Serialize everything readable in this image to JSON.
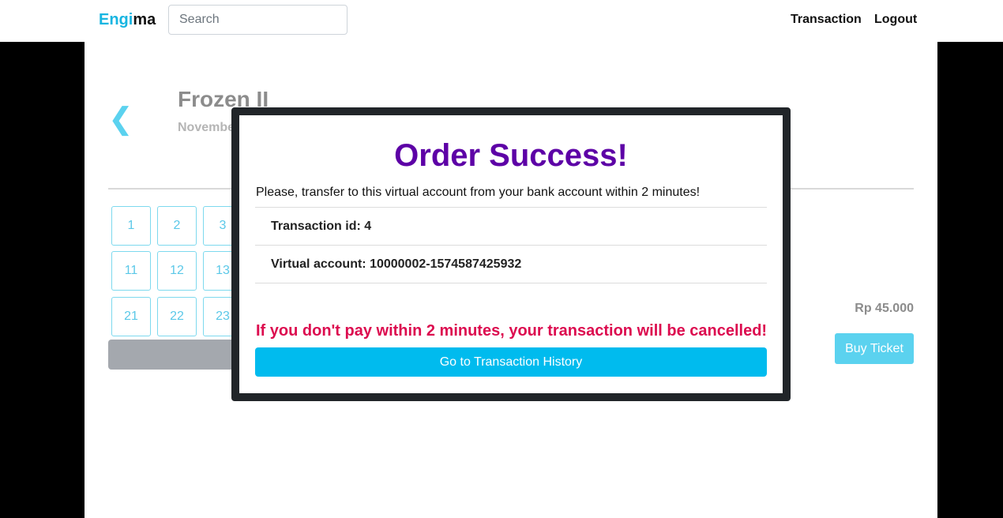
{
  "navbar": {
    "brand_part1": "Engi",
    "brand_part2": "ma",
    "search_placeholder": "Search",
    "transaction_label": "Transaction",
    "logout_label": "Logout"
  },
  "movie": {
    "back_icon": "❮",
    "title": "Frozen II",
    "date_partial": "Novembe",
    "price": "Rp 45.000",
    "buy_label": "Buy Ticket"
  },
  "seats": {
    "row1": [
      "1",
      "2",
      "3"
    ],
    "row2": [
      "11",
      "12",
      "13"
    ],
    "row3": [
      "21",
      "22",
      "23"
    ]
  },
  "modal": {
    "title": "Order Success!",
    "message": "Please, transfer to this virtual account from your bank account within 2 minutes!",
    "transaction_id": "Transaction id: 4",
    "virtual_account": "Virtual account: 10000002-1574587425932",
    "warning": "If you don't pay within 2 minutes, your transaction will be cancelled!",
    "history_button": "Go to Transaction History"
  },
  "colors": {
    "brand_accent": "#17b5e1",
    "title_purple": "#5d00a6",
    "warning_red": "#dc0b4f",
    "button_cyan": "#00bbee"
  }
}
